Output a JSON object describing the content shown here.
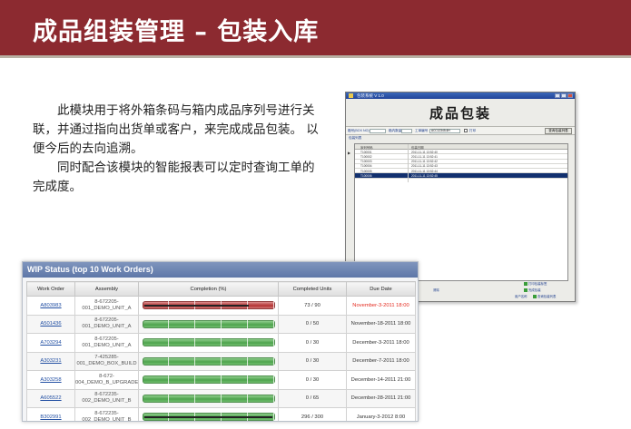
{
  "slide": {
    "title": "成品组装管理 – 包装入库"
  },
  "description": {
    "paragraph_1": "此模块用于将外箱条码与箱内成品序列号进行关联，并通过指向出货单或客户，来完成成品包装。 以便今后的去向追溯。",
    "paragraph_2": "同时配合该模块的智能报表可以定时查询工单的完成度。"
  },
  "app_window": {
    "window_title": "包装系统 V 1.0",
    "banner_title": "成品包装",
    "toolbar": {
      "label_1": "箱号(BOX NO)",
      "label_2": "箱内数量",
      "label_3": "工单编号",
      "field_value": "ACC12345-6H",
      "label_4": "打印",
      "right_button": "查询包装列表"
    },
    "sub_label": "包装列表",
    "grid": {
      "headers": [
        "序列号码",
        "包装日期"
      ],
      "rows": [
        {
          "serial": "T100001",
          "date": "2011-11-11 13:52:40",
          "selected": false
        },
        {
          "serial": "T100002",
          "date": "2011-11-11 13:52:41",
          "selected": false
        },
        {
          "serial": "T100003",
          "date": "2011-11-11 13:52:42",
          "selected": false
        },
        {
          "serial": "T100004",
          "date": "2011-11-11 13:52:43",
          "selected": false
        },
        {
          "serial": "T100005",
          "date": "2011-11-11 13:52:44",
          "selected": false
        },
        {
          "serial": "T100006",
          "date": "2011-11-11 13:52:45",
          "selected": true
        }
      ]
    },
    "footer": {
      "btn_print": "打印包装标签",
      "btn_reset": "清除",
      "btn_complete": "完成包装",
      "btn_query": "查询包装列表",
      "btn_exit": "退出",
      "status": "用户名称"
    }
  },
  "wip": {
    "title": "WIP Status (top 10 Work Orders)",
    "headers": {
      "work_order": "Work Order",
      "assembly": "Assembly",
      "completion": "Completion (%)",
      "completed_units": "Completed Units",
      "due_date": "Due Date"
    },
    "rows": [
      {
        "work_order": "A803983",
        "assembly": "8-672205-001_DEMO_UNIT_A",
        "progress": 0.81,
        "status_color": "#b33333",
        "completed_units": "73 / 90",
        "due_date": "November-3-2011 18:00",
        "late": true
      },
      {
        "work_order": "A501436",
        "assembly": "8-672205-001_DEMO_UNIT_A",
        "progress": 0,
        "status_color": "#4ea34d",
        "completed_units": "0 / 50",
        "due_date": "November-18-2011 18:00",
        "late": false
      },
      {
        "work_order": "A703294",
        "assembly": "8-672205-001_DEMO_UNIT_A",
        "progress": 0,
        "status_color": "#4ea34d",
        "completed_units": "0 / 30",
        "due_date": "December-3-2011 18:00",
        "late": false
      },
      {
        "work_order": "A303231",
        "assembly": "7-425285-001_DEMO_BOX_BUILD",
        "progress": 0,
        "status_color": "#4ea34d",
        "completed_units": "0 / 30",
        "due_date": "December-7-2011 18:00",
        "late": false
      },
      {
        "work_order": "A303258",
        "assembly": "8-672-004_DEMO_B_UPGRADE",
        "progress": 0,
        "status_color": "#4ea34d",
        "completed_units": "0 / 30",
        "due_date": "December-14-2011 21:00",
        "late": false
      },
      {
        "work_order": "A605522",
        "assembly": "8-672235-002_DEMO_UNIT_B",
        "progress": 0,
        "status_color": "#4ea34d",
        "completed_units": "0 / 65",
        "due_date": "December-28-2011 21:00",
        "late": false
      },
      {
        "work_order": "B302991",
        "assembly": "8-672235-002_DEMO_UNIT_B",
        "progress": 0.99,
        "status_color": "#4ea34d",
        "completed_units": "296 / 300",
        "due_date": "January-3-2012 8:00",
        "late": false
      }
    ]
  }
}
